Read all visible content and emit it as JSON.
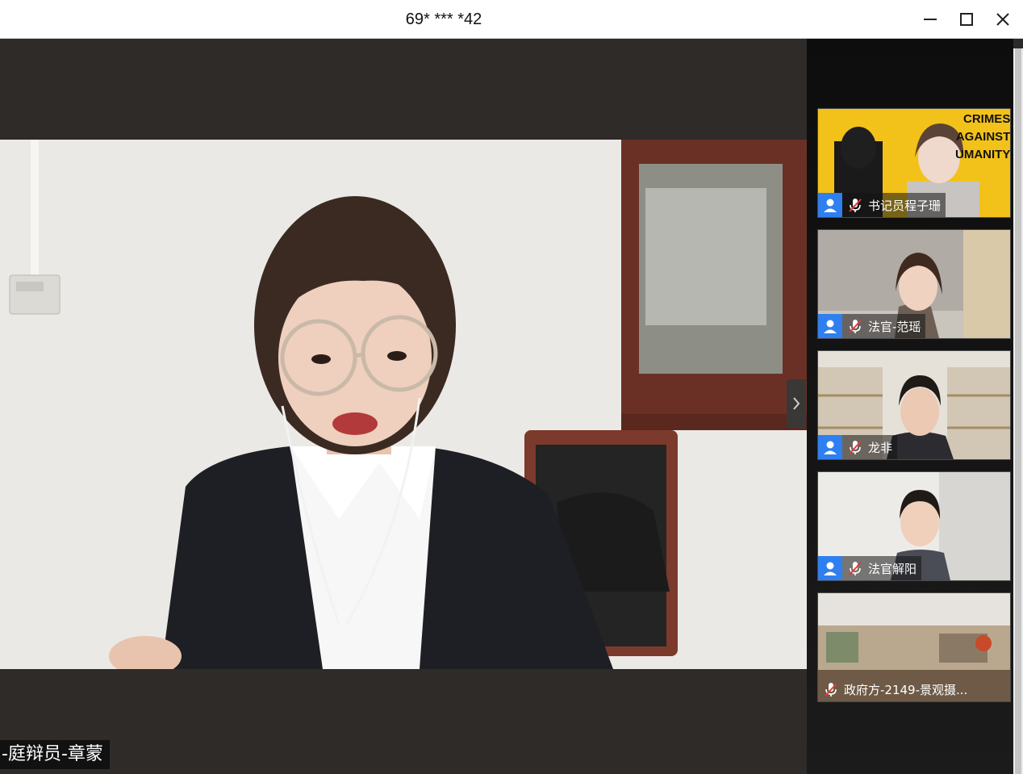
{
  "window": {
    "title": "69* *** *42",
    "controls": [
      "minimize-icon",
      "maximize-icon",
      "close-icon"
    ]
  },
  "main_video": {
    "participant_label": "-庭辩员-章蒙"
  },
  "sidebar": {
    "participants": [
      {
        "name": "书记员程子珊",
        "muted": true,
        "show_avatar": true,
        "overlay_text": [
          "CRIMES",
          "AGAINST",
          "UMANITY"
        ]
      },
      {
        "name": "法官-范瑶",
        "muted": true,
        "show_avatar": true
      },
      {
        "name": "龙非",
        "muted": true,
        "show_avatar": true
      },
      {
        "name": "法官解阳",
        "muted": true,
        "show_avatar": true
      },
      {
        "name": "政府方-2149-景观摄...",
        "muted": true,
        "show_avatar": false
      }
    ]
  },
  "colors": {
    "accent_avatar": "#2f7ff0",
    "muted_mic": "#e03b3b",
    "background": "#2e2b29"
  }
}
